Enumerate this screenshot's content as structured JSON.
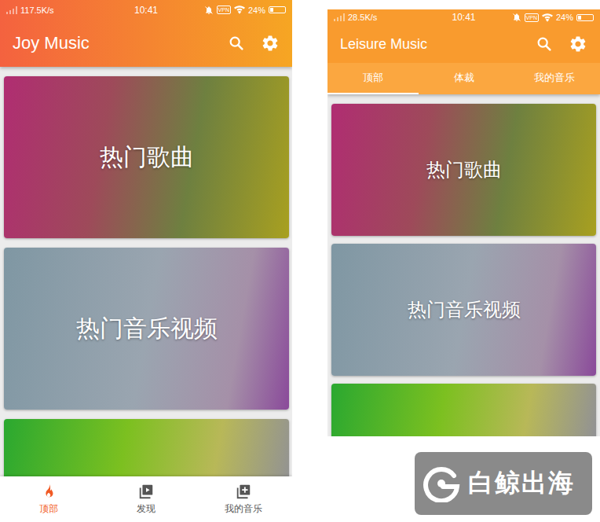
{
  "phones": [
    {
      "kind": "bottom-nav",
      "app_title": "Joy Music",
      "status_bar": {
        "speed": "117.5K/s",
        "time": "10:41",
        "vpn": "VPN",
        "battery": "24%",
        "battery_level": 0.24
      },
      "top_tabs": [],
      "cards": [
        {
          "title": "热门歌曲"
        },
        {
          "title": "热门音乐视频"
        },
        {
          "title": ""
        }
      ],
      "bottom_nav": [
        {
          "label": "顶部",
          "selected": true
        },
        {
          "label": "发现",
          "selected": false
        },
        {
          "label": "我的音乐",
          "selected": false
        }
      ]
    },
    {
      "kind": "top-tabs",
      "app_title": "Leisure Music",
      "status_bar": {
        "speed": "28.5K/s",
        "time": "10:41",
        "vpn": "VPN",
        "battery": "24%",
        "battery_level": 0.24
      },
      "top_tabs": [
        {
          "label": "顶部",
          "selected": true
        },
        {
          "label": "体裁",
          "selected": false
        },
        {
          "label": "我的音乐",
          "selected": false
        }
      ],
      "cards": [
        {
          "title": "热门歌曲"
        },
        {
          "title": "热门音乐视频"
        },
        {
          "title": ""
        }
      ],
      "bottom_nav": []
    }
  ],
  "watermark": {
    "text": "白鲸出海"
  }
}
